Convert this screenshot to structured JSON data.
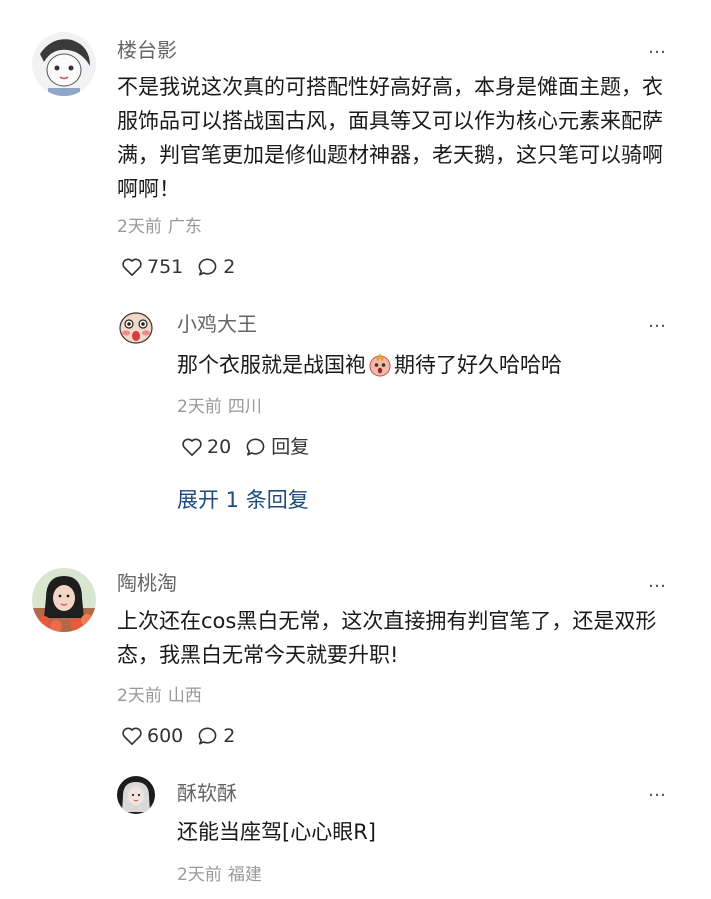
{
  "comments": [
    {
      "user": "楼台影",
      "text": "不是我说这次真的可搭配性好高好高，本身是傩面主题，衣服饰品可以搭战国古风，面具等又可以作为核心元素来配萨满，判官笔更加是修仙题材神器，老天鹅，这只笔可以骑啊啊啊！",
      "time": "2天前",
      "location": "广东",
      "likes": "751",
      "replies": "2",
      "more_icon": "…",
      "reply": {
        "user": "小鸡大王",
        "text_before": "那个衣服就是战国袍",
        "emoji": "surprised-face-emoji",
        "text_after": "期待了好久哈哈哈",
        "time": "2天前",
        "location": "四川",
        "likes": "20",
        "reply_label": "回复",
        "more_icon": "…"
      },
      "expand_label": "展开 1 条回复"
    },
    {
      "user": "陶桃淘",
      "text": "上次还在cos黑白无常，这次直接拥有判官笔了，还是双形态，我黑白无常今天就要升职!",
      "time": "2天前",
      "location": "山西",
      "likes": "600",
      "replies": "2",
      "more_icon": "…",
      "reply": {
        "user": "酥软酥",
        "text": "还能当座驾[心心眼R]",
        "time": "2天前",
        "location": "福建",
        "more_icon": "…"
      }
    }
  ],
  "icons": {
    "like": "heart-outline-icon",
    "comment": "speech-bubble-icon",
    "more": "ellipsis-icon"
  },
  "colors": {
    "link": "#1f4a7a",
    "meta": "#999999",
    "name": "#666666"
  }
}
